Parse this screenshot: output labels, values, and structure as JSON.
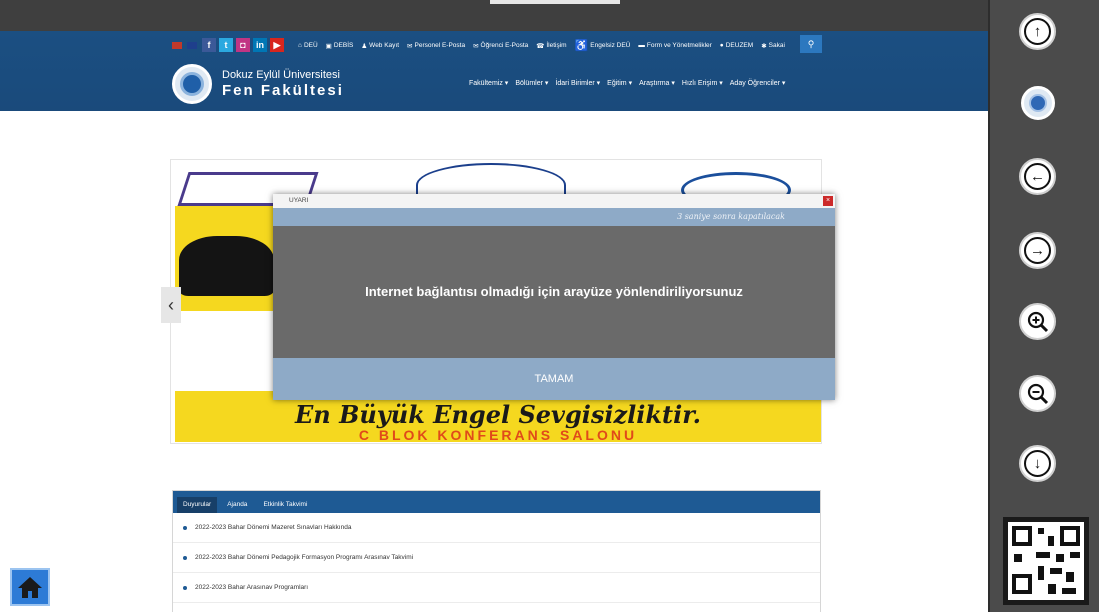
{
  "header": {
    "utility_links": [
      "DEÜ",
      "DEBİS",
      "Web Kayıt",
      "Personel E-Posta",
      "Öğrenci E-Posta",
      "İletişim",
      "Engelsiz DEÜ",
      "Form ve Yönetmelikler",
      "DEUZEM",
      "Sakai"
    ],
    "university_name": "Dokuz Eylül Üniversitesi",
    "faculty_name": "Fen Fakültesi",
    "nav_items": [
      "Fakültemiz",
      "Bölümler",
      "İdari Birimler",
      "Eğitim",
      "Araştırma",
      "Hızlı Erişim",
      "Aday Öğrenciler"
    ],
    "colors": {
      "header_bg": "#1b4f82",
      "search_bg": "#2c78bf"
    }
  },
  "slider": {
    "slogan": "En Büyük Engel Sevgisizliktir.",
    "hall_caption": "C BLOK KONFERANS SALONU",
    "prev_icon": "chevron-left-icon"
  },
  "modal": {
    "title": "UYARI",
    "countdown": "3 saniye sonra kapatılacak",
    "message": "Internet bağlantısı olmadığı için arayüze yönlendiriliyorsunuz",
    "ok_label": "TAMAM",
    "colors": {
      "body": "#6a6a6a",
      "bar": "#8eaac7",
      "close": "#cc2a2a"
    }
  },
  "tabs": {
    "items": [
      "Duyurular",
      "Ajanda",
      "Etkinlik Takvimi"
    ],
    "news": [
      "2022-2023 Bahar Dönemi Mazeret Sınavları Hakkında",
      "2022-2023 Bahar Dönemi Pedagojik Formasyon Programı Arasınav Takvimi",
      "2022-2023 Bahar Arasınav Programları"
    ]
  },
  "side_panel": {
    "buttons": [
      "scroll-up-icon",
      "faculty-logo-icon",
      "back-icon",
      "forward-icon",
      "zoom-in-icon",
      "zoom-out-icon",
      "scroll-down-icon"
    ],
    "qr": "qr-code"
  }
}
